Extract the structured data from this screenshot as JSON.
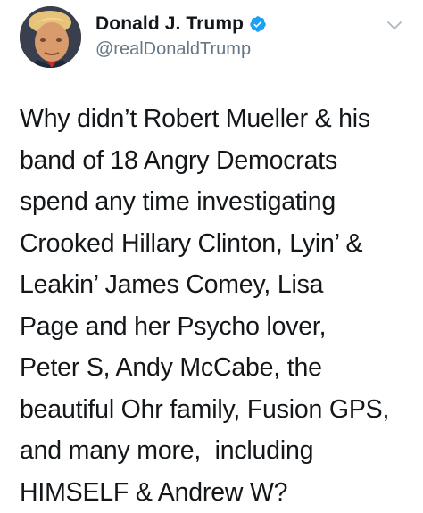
{
  "tweet": {
    "author": {
      "display_name": "Donald J. Trump",
      "handle": "@realDonaldTrump",
      "verified": true,
      "verified_color": "#1da1f2"
    },
    "menu_icon": "chevron-down-icon",
    "text_lines": [
      "Why didn’t Robert Mueller & his",
      "band of 18 Angry Democrats",
      "spend any time investigating",
      "Crooked Hillary Clinton, Lyin’ &",
      "Leakin’ James Comey, Lisa",
      "Page and her Psycho lover,",
      "Peter S, Andy McCabe, the",
      "beautiful Ohr family, Fusion GPS,",
      "and many more,  including",
      "HIMSELF & Andrew W?"
    ]
  }
}
